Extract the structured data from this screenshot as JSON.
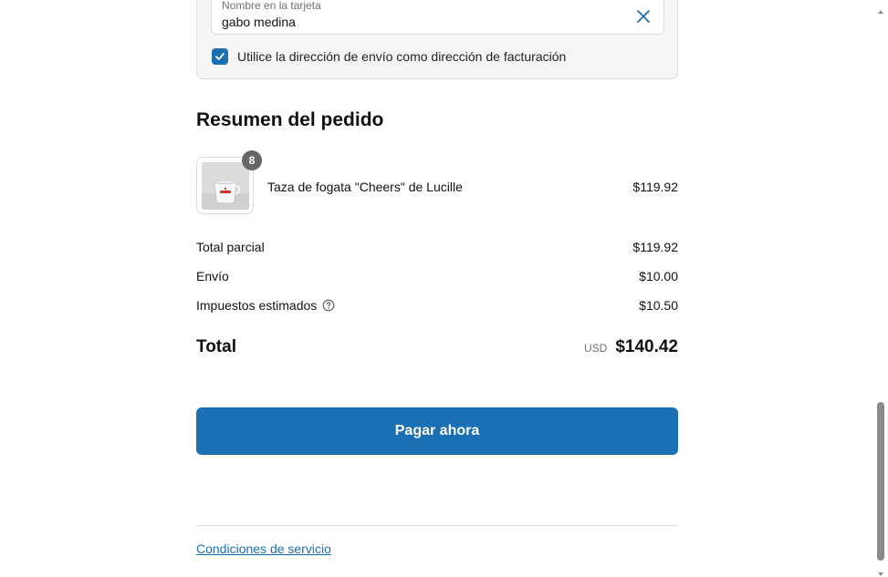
{
  "billing": {
    "name_field": {
      "label": "Nombre en la tarjeta",
      "value": "gabo medina"
    },
    "same_address_checkbox": {
      "checked": true,
      "label": "Utilice la dirección de envío como dirección de facturación"
    }
  },
  "summary": {
    "title": "Resumen del pedido",
    "product": {
      "name": "Taza de fogata \"Cheers\" de Lucille",
      "price": "$119.92",
      "quantity": "8",
      "thumbnail_icon": "camp-mug-image"
    },
    "lines": [
      {
        "label": "Total parcial",
        "value": "$119.92"
      },
      {
        "label": "Envío",
        "value": "$10.00"
      },
      {
        "label": "Impuestos estimados",
        "value": "$10.50",
        "icon": "help-icon"
      }
    ],
    "total": {
      "label": "Total",
      "currency": "USD",
      "value": "$140.42"
    }
  },
  "pay_button": {
    "label": "Pagar ahora"
  },
  "footer": {
    "terms_link": "Condiciones de servicio"
  },
  "colors": {
    "accent": "#1b6fb3",
    "card_background": "#f5f5f5",
    "badge": "#666666"
  }
}
